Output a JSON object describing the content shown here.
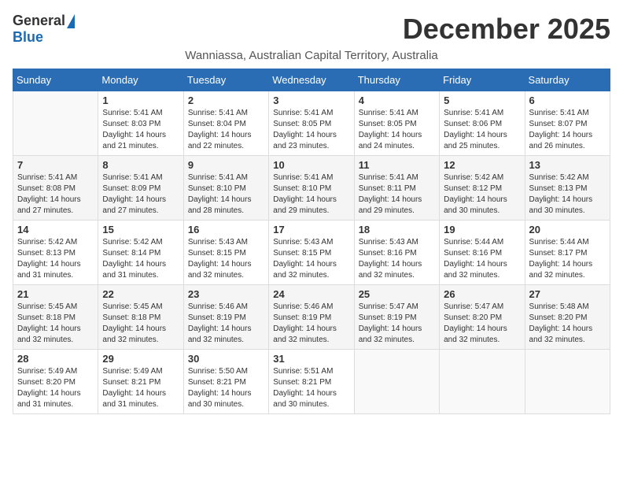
{
  "header": {
    "logo_general": "General",
    "logo_blue": "Blue",
    "month": "December 2025",
    "location": "Wanniassa, Australian Capital Territory, Australia"
  },
  "days_of_week": [
    "Sunday",
    "Monday",
    "Tuesday",
    "Wednesday",
    "Thursday",
    "Friday",
    "Saturday"
  ],
  "weeks": [
    [
      {
        "day": "",
        "info": ""
      },
      {
        "day": "1",
        "info": "Sunrise: 5:41 AM\nSunset: 8:03 PM\nDaylight: 14 hours\nand 21 minutes."
      },
      {
        "day": "2",
        "info": "Sunrise: 5:41 AM\nSunset: 8:04 PM\nDaylight: 14 hours\nand 22 minutes."
      },
      {
        "day": "3",
        "info": "Sunrise: 5:41 AM\nSunset: 8:05 PM\nDaylight: 14 hours\nand 23 minutes."
      },
      {
        "day": "4",
        "info": "Sunrise: 5:41 AM\nSunset: 8:05 PM\nDaylight: 14 hours\nand 24 minutes."
      },
      {
        "day": "5",
        "info": "Sunrise: 5:41 AM\nSunset: 8:06 PM\nDaylight: 14 hours\nand 25 minutes."
      },
      {
        "day": "6",
        "info": "Sunrise: 5:41 AM\nSunset: 8:07 PM\nDaylight: 14 hours\nand 26 minutes."
      }
    ],
    [
      {
        "day": "7",
        "info": "Sunrise: 5:41 AM\nSunset: 8:08 PM\nDaylight: 14 hours\nand 27 minutes."
      },
      {
        "day": "8",
        "info": "Sunrise: 5:41 AM\nSunset: 8:09 PM\nDaylight: 14 hours\nand 27 minutes."
      },
      {
        "day": "9",
        "info": "Sunrise: 5:41 AM\nSunset: 8:10 PM\nDaylight: 14 hours\nand 28 minutes."
      },
      {
        "day": "10",
        "info": "Sunrise: 5:41 AM\nSunset: 8:10 PM\nDaylight: 14 hours\nand 29 minutes."
      },
      {
        "day": "11",
        "info": "Sunrise: 5:41 AM\nSunset: 8:11 PM\nDaylight: 14 hours\nand 29 minutes."
      },
      {
        "day": "12",
        "info": "Sunrise: 5:42 AM\nSunset: 8:12 PM\nDaylight: 14 hours\nand 30 minutes."
      },
      {
        "day": "13",
        "info": "Sunrise: 5:42 AM\nSunset: 8:13 PM\nDaylight: 14 hours\nand 30 minutes."
      }
    ],
    [
      {
        "day": "14",
        "info": "Sunrise: 5:42 AM\nSunset: 8:13 PM\nDaylight: 14 hours\nand 31 minutes."
      },
      {
        "day": "15",
        "info": "Sunrise: 5:42 AM\nSunset: 8:14 PM\nDaylight: 14 hours\nand 31 minutes."
      },
      {
        "day": "16",
        "info": "Sunrise: 5:43 AM\nSunset: 8:15 PM\nDaylight: 14 hours\nand 32 minutes."
      },
      {
        "day": "17",
        "info": "Sunrise: 5:43 AM\nSunset: 8:15 PM\nDaylight: 14 hours\nand 32 minutes."
      },
      {
        "day": "18",
        "info": "Sunrise: 5:43 AM\nSunset: 8:16 PM\nDaylight: 14 hours\nand 32 minutes."
      },
      {
        "day": "19",
        "info": "Sunrise: 5:44 AM\nSunset: 8:16 PM\nDaylight: 14 hours\nand 32 minutes."
      },
      {
        "day": "20",
        "info": "Sunrise: 5:44 AM\nSunset: 8:17 PM\nDaylight: 14 hours\nand 32 minutes."
      }
    ],
    [
      {
        "day": "21",
        "info": "Sunrise: 5:45 AM\nSunset: 8:18 PM\nDaylight: 14 hours\nand 32 minutes."
      },
      {
        "day": "22",
        "info": "Sunrise: 5:45 AM\nSunset: 8:18 PM\nDaylight: 14 hours\nand 32 minutes."
      },
      {
        "day": "23",
        "info": "Sunrise: 5:46 AM\nSunset: 8:19 PM\nDaylight: 14 hours\nand 32 minutes."
      },
      {
        "day": "24",
        "info": "Sunrise: 5:46 AM\nSunset: 8:19 PM\nDaylight: 14 hours\nand 32 minutes."
      },
      {
        "day": "25",
        "info": "Sunrise: 5:47 AM\nSunset: 8:19 PM\nDaylight: 14 hours\nand 32 minutes."
      },
      {
        "day": "26",
        "info": "Sunrise: 5:47 AM\nSunset: 8:20 PM\nDaylight: 14 hours\nand 32 minutes."
      },
      {
        "day": "27",
        "info": "Sunrise: 5:48 AM\nSunset: 8:20 PM\nDaylight: 14 hours\nand 32 minutes."
      }
    ],
    [
      {
        "day": "28",
        "info": "Sunrise: 5:49 AM\nSunset: 8:20 PM\nDaylight: 14 hours\nand 31 minutes."
      },
      {
        "day": "29",
        "info": "Sunrise: 5:49 AM\nSunset: 8:21 PM\nDaylight: 14 hours\nand 31 minutes."
      },
      {
        "day": "30",
        "info": "Sunrise: 5:50 AM\nSunset: 8:21 PM\nDaylight: 14 hours\nand 30 minutes."
      },
      {
        "day": "31",
        "info": "Sunrise: 5:51 AM\nSunset: 8:21 PM\nDaylight: 14 hours\nand 30 minutes."
      },
      {
        "day": "",
        "info": ""
      },
      {
        "day": "",
        "info": ""
      },
      {
        "day": "",
        "info": ""
      }
    ]
  ]
}
